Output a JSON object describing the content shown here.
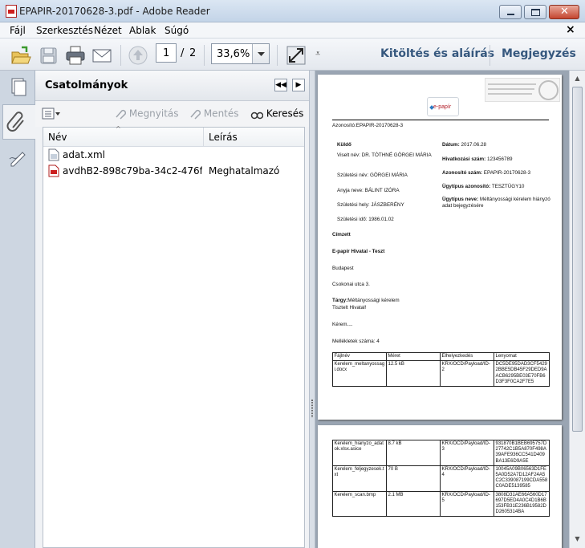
{
  "window": {
    "title": "EPAPIR-20170628-3.pdf - Adobe Reader"
  },
  "menu": {
    "items": [
      "Fájl",
      "Szerkesztés",
      "Nézet",
      "Ablak",
      "Súgó"
    ],
    "close_glyph": "×"
  },
  "toolbar": {
    "page_current": "1",
    "page_separator": "/",
    "page_total": "2",
    "zoom": "33,6%",
    "right_links": [
      "Kitöltés és aláírás",
      "Megjegyzés"
    ]
  },
  "attachments": {
    "title": "Csatolmányok",
    "actions": {
      "open": "Megnyitás",
      "save": "Mentés",
      "search": "Keresés"
    },
    "columns": {
      "name": "Név",
      "description": "Leírás"
    },
    "files": [
      {
        "name": "adat.xml",
        "description": "",
        "icon": "xml-file-icon"
      },
      {
        "name": "avdhB2-898c79ba-34c2-476f-be...",
        "description": "Meghatalmazó",
        "icon": "pdf-file-icon"
      }
    ]
  },
  "document": {
    "logo_text": "e-papír",
    "identifier": "Azonosító:EPAPIR-20170628-3",
    "sender_heading": "Küldő",
    "left_fields": [
      "Viselt név: DR. TÓTHNÉ GÖRGEI MÁRIA",
      "Születési név: GÖRGEI MÁRIA",
      "Anyja neve: BÁLINT IZÓRA",
      "Születési hely: JÁSZBERÉNY",
      "Születési idő: 1986.01.02"
    ],
    "right_fields": [
      {
        "label": "Dátum:",
        "value": "2017.06.28"
      },
      {
        "label": "Hivatkozási szám:",
        "value": "123456789"
      },
      {
        "label": "Azonosító szám:",
        "value": "EPAPIR-20170628-3"
      },
      {
        "label": "Ügytípus azonosító:",
        "value": "TESZTÜGY10"
      },
      {
        "label": "Ügytípus neve:",
        "value": "Méltányossági kérelem hiányzó adat bejegyzésére"
      }
    ],
    "recipient_heading": "Címzett",
    "recipient_name": "E-papír Hivatal - Teszt",
    "city": "Budapest",
    "street": "Csokonai utca 3.",
    "subject_label": "Tárgy:",
    "subject_value": "Méltányossági kérelem",
    "greeting": "Tisztelt Hivatal!",
    "request": "Kérem....",
    "attachments_count": "Mellékletek száma: 4",
    "table_headers": [
      "Fájlnév",
      "Méret",
      "Elhelyezkedés",
      "Lenyomat"
    ],
    "table_rows_page1": [
      [
        "Kerelem_meltanyossagi.docx",
        "12.5 kB",
        "KRX/OCD/Payload/ID-2",
        "DC5DE95DAD3CF54292BBE5DB45F29DED9AACB6295BE03E70FB6D3F3F0CA2F7E5"
      ]
    ],
    "table_rows_page2": [
      [
        "Kerelem_hianyzo_adatok.xlsx.asice",
        "8.7 kB",
        "KRX/OCD/Payload/ID-3",
        "931870B1BEB695757D27742C1B5A870F498A39AFE936CC541D409BA13E6D9A5E"
      ],
      [
        "Kerelem_feljegyzesek.txt",
        "70 B",
        "KRX/OCD/Payload/ID-4",
        "10045A09B06563D1FE5A0D52A7D12AF24A5C2C339087199CDA558C0ADE5139585"
      ],
      [
        "Kerelem_scan.bmp",
        "2.1 MB",
        "KRX/OCD/Payload/ID-5",
        "3808D31AE66A560D17697D5ED4A0C4D1B6B153FB31E236B19582DD2605314BA"
      ]
    ]
  },
  "colors": {
    "accent_link": "#36587e",
    "pdf_red": "#cc1f1f"
  }
}
